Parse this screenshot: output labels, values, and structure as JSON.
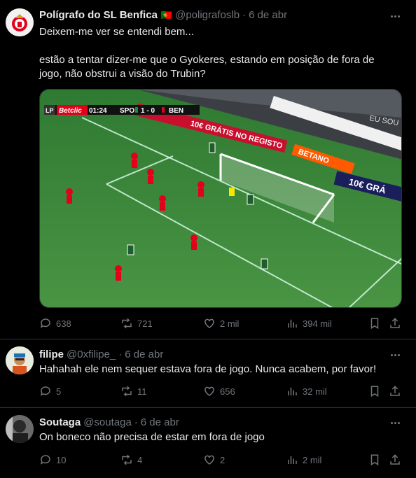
{
  "tweets": [
    {
      "name": "Polígrafo do SL Benfica",
      "flag": "🇵🇹",
      "handle": "@poligrafoslb",
      "dot": "·",
      "time": "6 de abr",
      "lines": [
        "Deixem-me ver se entendi bem...",
        "",
        "estão a tentar dizer-me que o Gyokeres, estando em posição de fora de",
        "jogo, não obstrui a visão do Trubin?"
      ],
      "replies": "638",
      "reposts": "721",
      "likes": "2 mil",
      "views": "394 mil",
      "media": {
        "sponsor": "Betclic",
        "clock": "01:24",
        "home": "SPO",
        "score": "1 - 0",
        "away": "BEN",
        "board1": "10€ GRÁTIS NO REGISTO",
        "board2": "BETANO",
        "board3": "10€ GRÁ",
        "board4": "EU SOU"
      }
    },
    {
      "name": "filipe",
      "handle": "@0xfilipe_",
      "dot": "·",
      "time": "6 de abr",
      "lines": [
        "Hahahah ele nem sequer estava fora de jogo. Nunca acabem, por favor!"
      ],
      "replies": "5",
      "reposts": "11",
      "likes": "656",
      "views": "32 mil"
    },
    {
      "name": "Soutaga",
      "handle": "@soutaga",
      "dot": "·",
      "time": "6 de abr",
      "lines": [
        "On boneco não precisa de estar em fora de jogo"
      ],
      "replies": "10",
      "reposts": "4",
      "likes": "2",
      "views": "2 mil"
    }
  ],
  "colors": {
    "bg": "#000000",
    "text": "#e7e9ea",
    "muted": "#71767b",
    "border": "#2f3336",
    "benfica_red": "#e2001a",
    "pitch": "#3f8a3a"
  }
}
